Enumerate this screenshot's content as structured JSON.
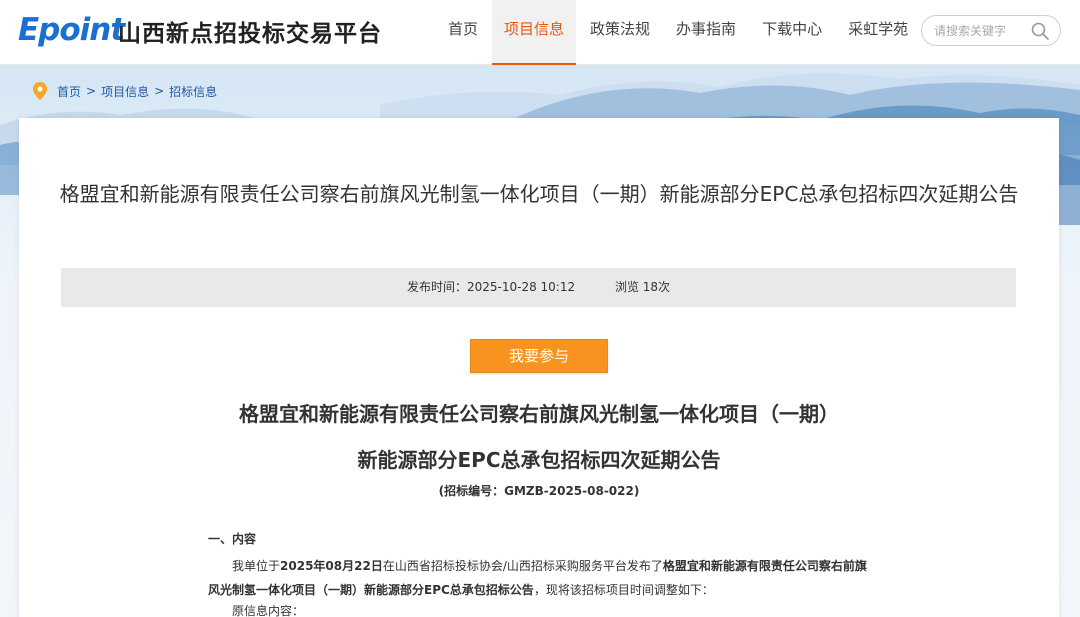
{
  "header": {
    "logo_text": "Epoint",
    "site_name": "山西新点招投标交易平台",
    "nav": [
      {
        "label": "首页",
        "active": false
      },
      {
        "label": "项目信息",
        "active": true
      },
      {
        "label": "政策法规",
        "active": false
      },
      {
        "label": "办事指南",
        "active": false
      },
      {
        "label": "下载中心",
        "active": false
      },
      {
        "label": "采虹学苑",
        "active": false
      }
    ],
    "search_placeholder": "请搜索关键字",
    "accent_color": "#e9580c",
    "brand_color": "#1a6fd1"
  },
  "breadcrumb": [
    "首页",
    "项目信息",
    "招标信息"
  ],
  "breadcrumb_sep": ">",
  "article": {
    "title": "格盟宜和新能源有限责任公司察右前旗风光制氢一体化项目（一期）新能源部分EPC总承包招标四次延期公告",
    "publish_time": "发布时间：2025-10-28 10:12",
    "views": "浏览 18次",
    "join_button": "我要参与",
    "doc_title_line1": "格盟宜和新能源有限责任公司察右前旗风光制氢一体化项目（一期）",
    "doc_title_line2": "新能源部分EPC总承包招标四次延期公告",
    "doc_code": "(招标编号：GMZB-2025-08-022)",
    "section1_heading": "一、内容",
    "para_prefix": "我单位于",
    "para_date": "2025年08月22日",
    "para_mid": "在山西省招标投标协会/山西招标采购服务平台发布了",
    "para_bold_name": "格盟宜和新能源有限责任公司察右前旗风光制氢一体化项目（一期）新能源部分EPC总承包招标公告",
    "para_suffix": "，现将该招标项目时间调整如下：",
    "orig_info": "原信息内容："
  }
}
